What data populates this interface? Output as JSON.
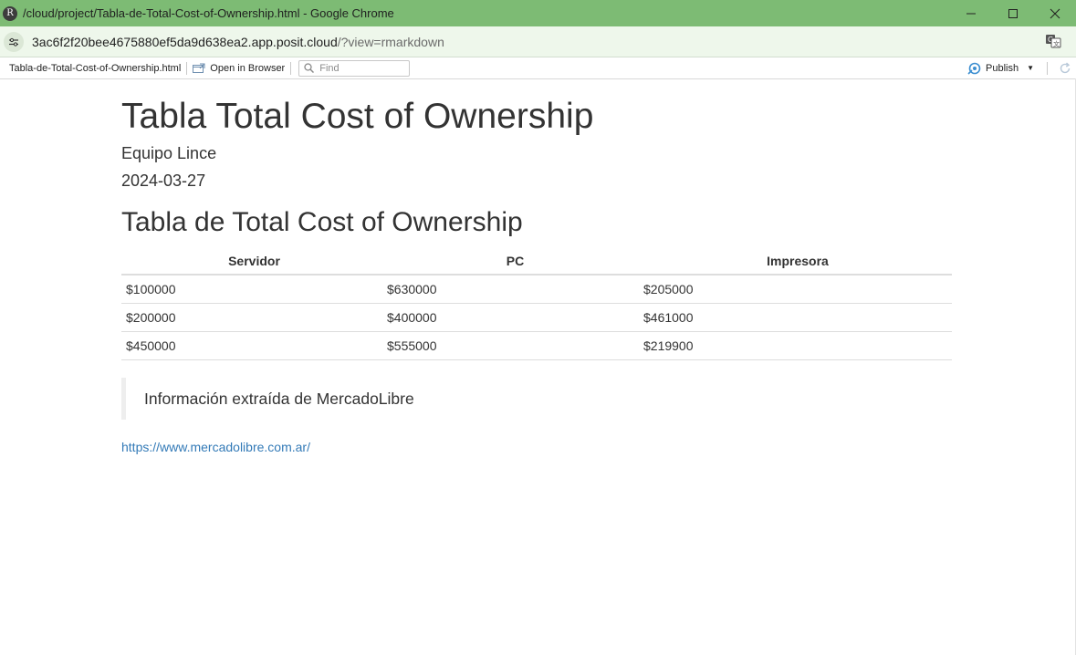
{
  "window": {
    "title": "/cloud/project/Tabla-de-Total-Cost-of-Ownership.html - Google Chrome",
    "app_icon_letter": "R"
  },
  "address_bar": {
    "host": "3ac6f2f20bee4675880ef5da9d638ea2.app.posit.cloud",
    "path": "/?view=rmarkdown"
  },
  "toolbar": {
    "file_name": "Tabla-de-Total-Cost-of-Ownership.html",
    "open_in_browser": "Open in Browser",
    "find_placeholder": "Find",
    "publish_label": "Publish"
  },
  "document": {
    "title": "Tabla Total Cost of Ownership",
    "author": "Equipo Lince",
    "date": "2024-03-27",
    "section_title": "Tabla de Total Cost of Ownership",
    "table": {
      "headers": [
        "Servidor",
        "PC",
        "Impresora"
      ],
      "rows": [
        [
          "$100000",
          "$630000",
          "$205000"
        ],
        [
          "$200000",
          "$400000",
          "$461000"
        ],
        [
          "$450000",
          "$555000",
          "$219900"
        ]
      ]
    },
    "blockquote": "Información extraída de MercadoLibre",
    "link": "https://www.mercadolibre.com.ar/"
  },
  "colors": {
    "titlebar": "#7dbb74",
    "addressbar": "#eef7eb",
    "link": "#337ab7",
    "text": "#333333"
  },
  "icons": [
    "r-logo-icon",
    "minimize-icon",
    "maximize-icon",
    "close-icon",
    "site-info-icon",
    "translate-icon",
    "open-in-browser-icon",
    "search-icon",
    "publish-icon",
    "caret-down-icon",
    "refresh-icon"
  ]
}
